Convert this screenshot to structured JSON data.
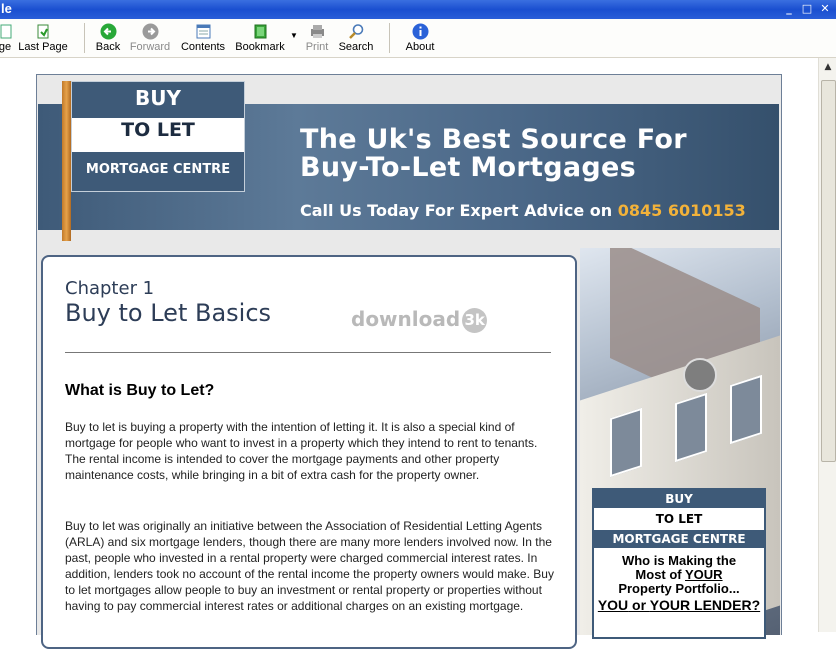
{
  "window": {
    "title": "le"
  },
  "toolbar": {
    "buttons": [
      {
        "label": "ge",
        "icon": "home-page-icon"
      },
      {
        "label": "Last Page",
        "icon": "last-page-icon"
      },
      {
        "label": "Back",
        "icon": "back-arrow-icon"
      },
      {
        "label": "Forward",
        "icon": "forward-arrow-icon"
      },
      {
        "label": "Contents",
        "icon": "contents-icon"
      },
      {
        "label": "Bookmark",
        "icon": "bookmark-icon"
      },
      {
        "label": "Print",
        "icon": "print-icon"
      },
      {
        "label": "Search",
        "icon": "search-icon"
      },
      {
        "label": "About",
        "icon": "info-icon"
      }
    ]
  },
  "banner": {
    "logo_buy": "BUY",
    "logo_to_let": "TO LET",
    "logo_centre": "MORTGAGE CENTRE",
    "headline1": "The Uk's Best Source For",
    "headline2": "Buy-To-Let Mortgages",
    "call_text": "Call Us Today For Expert Advice on",
    "phone": "0845 6010153"
  },
  "article": {
    "chapter": "Chapter 1",
    "title": "Buy to Let Basics",
    "watermark": "download",
    "watermark_badge": "3k",
    "question": "What is Buy to Let?",
    "para1": "Buy to let is buying a property with the intention of letting it. It is also a special kind of mortgage for people who want to invest in a property which they intend to rent to tenants. The rental income is intended to cover the mortgage payments and other property maintenance costs, while bringing in a bit of extra cash for the property owner.",
    "para2": "Buy to let was originally an initiative between the Association of Residential Letting Agents (ARLA) and six mortgage lenders, though there are many more lenders involved now. In the past, people who invested in a rental property were charged commercial interest rates. In addition, lenders took no account of the rental income the property owners would make. Buy to let mortgages allow people to buy an investment or rental property or properties without having to pay commercial interest rates or additional charges on an existing mortgage."
  },
  "side_sign": {
    "buy": "BUY",
    "to_let": "TO LET",
    "centre": "MORTGAGE CENTRE",
    "line1": "Who is Making the",
    "line2a": "Most of ",
    "line2b": "YOUR",
    "line3": "Property Portfolio...",
    "line4a": "YOU",
    "line4b": " or ",
    "line4c": "YOUR LENDER?"
  }
}
